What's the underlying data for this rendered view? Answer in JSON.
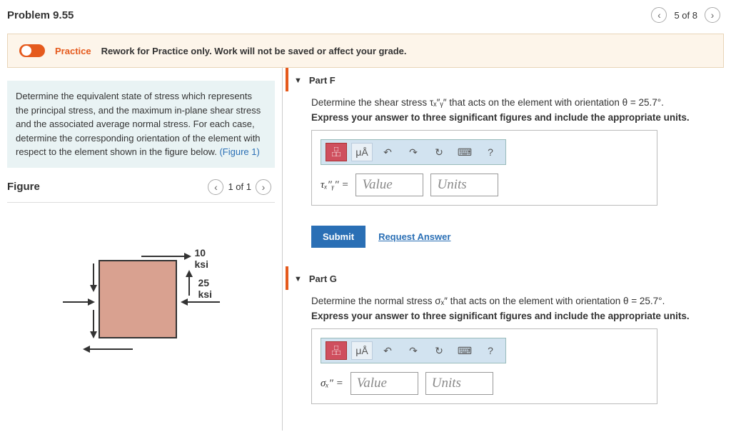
{
  "header": {
    "title": "Problem 9.55",
    "counter": "5 of 8"
  },
  "practice": {
    "label": "Practice",
    "text": "Rework for Practice only. Work will not be saved or affect your grade."
  },
  "prompt": {
    "text": "Determine the equivalent state of stress which represents the principal stress, and the maximum in-plane shear stress and the associated average normal stress. For each case, determine the corresponding orientation of the element with respect to the element shown in the figure below. ",
    "link": "(Figure 1)"
  },
  "figure": {
    "title": "Figure",
    "counter": "1 of 1",
    "label_top": "10 ksi",
    "label_side": "25 ksi"
  },
  "parts": {
    "f": {
      "title": "Part F",
      "line1": "Determine the shear stress τₓ″ᵧ″ that acts on the element with orientation θ = 25.7°.",
      "line2": "Express your answer to three significant figures and include the appropriate units.",
      "symbol": "τₓ″ᵧ″ ="
    },
    "g": {
      "title": "Part G",
      "line1": "Determine the normal stress σₓ″ that acts on the element with orientation θ = 25.7°.",
      "line2": "Express your answer to three significant figures and include the appropriate units.",
      "symbol": "σₓ″ ="
    }
  },
  "fields": {
    "value": "Value",
    "units": "Units"
  },
  "buttons": {
    "submit": "Submit",
    "request": "Request Answer",
    "greek": "μÅ",
    "help": "?"
  }
}
